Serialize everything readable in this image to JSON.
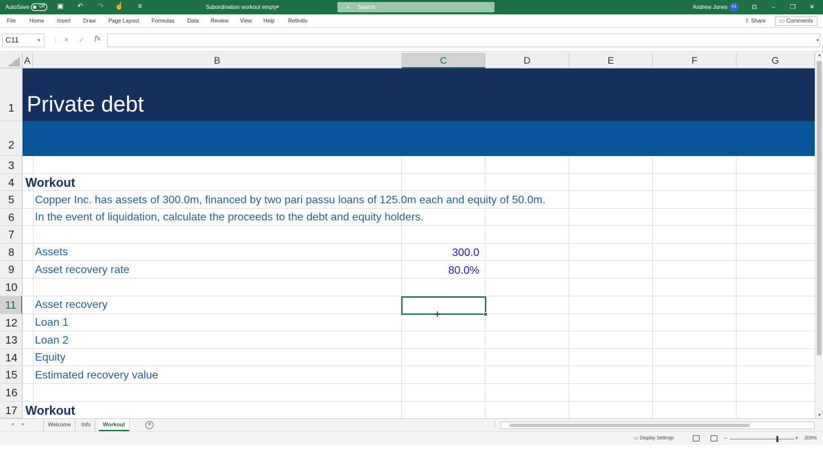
{
  "titlebar": {
    "autosave_label": "AutoSave",
    "autosave_state": "Off",
    "document_title": "Subordination workout empty",
    "search_placeholder": "Search",
    "user_name": "Andrew Jones",
    "user_initials": "AJ"
  },
  "ribbon": {
    "tabs": [
      "File",
      "Home",
      "Insert",
      "Draw",
      "Page Layout",
      "Formulas",
      "Data",
      "Review",
      "View",
      "Help",
      "Refinitiv"
    ],
    "share_label": "Share",
    "comments_label": "Comments"
  },
  "formula_bar": {
    "name_box": "C11",
    "fx_label": "fx",
    "formula": ""
  },
  "columns": [
    "A",
    "B",
    "C",
    "D",
    "E",
    "F",
    "G"
  ],
  "selected_column": "C",
  "rows": [
    "1",
    "2",
    "3",
    "4",
    "5",
    "6",
    "7",
    "8",
    "9",
    "10",
    "11",
    "12",
    "13",
    "14",
    "15",
    "16",
    "17"
  ],
  "selected_row": "11",
  "sheet": {
    "title": "Private debt",
    "heading_1": "Workout",
    "description_1": "Copper Inc. has assets of 300.0m, financed by two pari passu loans of 125.0m each and equity of 50.0m.",
    "description_2": "In the event of liquidation, calculate the proceeds to the debt and equity holders.",
    "labels": {
      "assets": "Assets",
      "asset_recovery_rate": "Asset recovery rate",
      "asset_recovery": "Asset recovery",
      "loan_1": "Loan 1",
      "loan_2": "Loan 2",
      "equity": "Equity",
      "estimated_recovery_value": "Estimated recovery value"
    },
    "values": {
      "assets": "300.0",
      "asset_recovery_rate": "80.0%"
    },
    "heading_2": "Workout"
  },
  "sheet_tabs": [
    "Welcome",
    "Info",
    "Workout"
  ],
  "active_sheet": "Workout",
  "statusbar": {
    "display_settings": "Display Settings",
    "zoom": "205%"
  },
  "colors": {
    "excel_green": "#217346",
    "title_band": "#16305e",
    "subtitle_band": "#0a5599",
    "label_text": "#1f5d8c",
    "input_value": "#1a1aaa"
  }
}
